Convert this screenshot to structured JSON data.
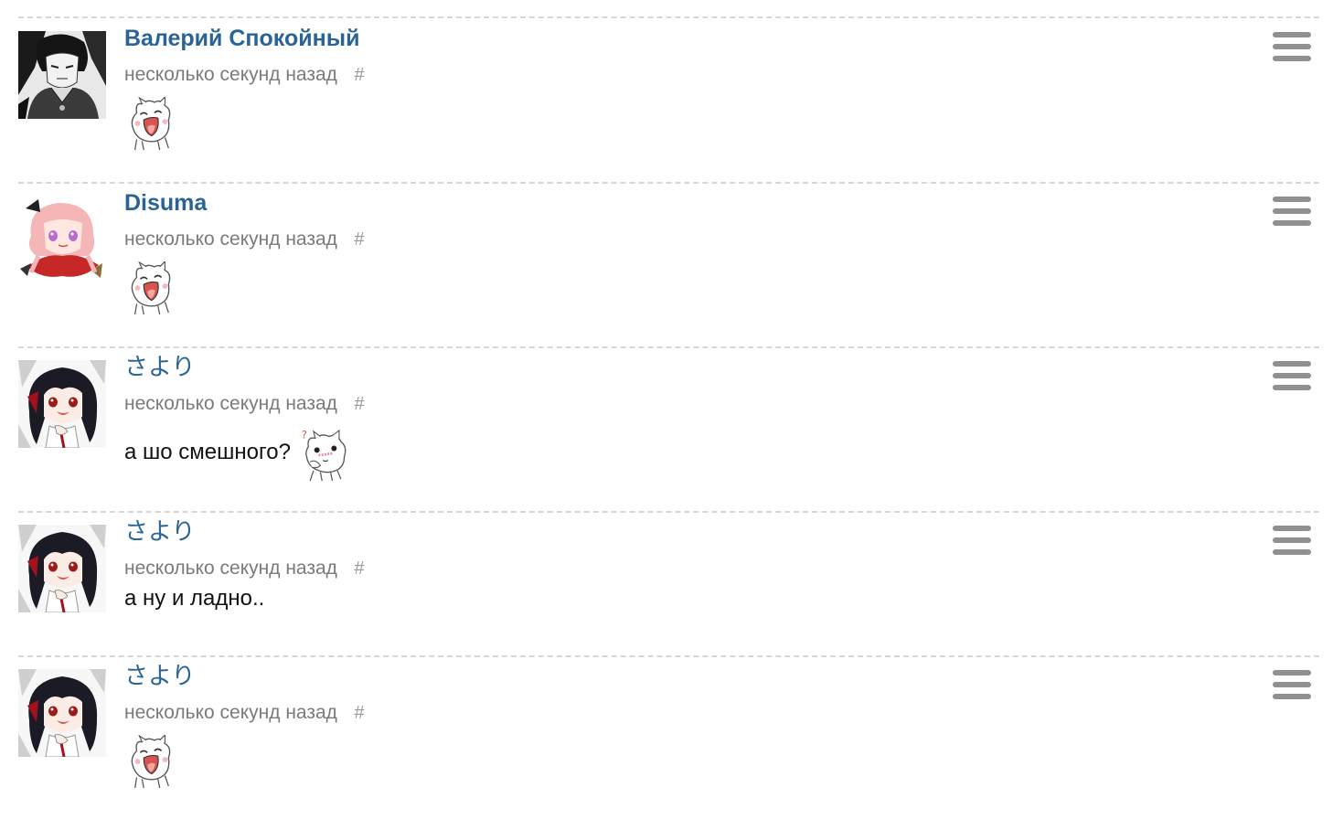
{
  "comments": [
    {
      "username": "Валерий Спокойный",
      "timestamp": "несколько секунд назад",
      "permalink": "#",
      "text": "",
      "sticker": "laughing-cat-sticker"
    },
    {
      "username": "Disuma",
      "timestamp": "несколько секунд назад",
      "permalink": "#",
      "text": "",
      "sticker": "laughing-cat-sticker"
    },
    {
      "username": "さより",
      "timestamp": "несколько секунд назад",
      "permalink": "#",
      "text": "а шо смешного?",
      "sticker": "confused-cat-sticker"
    },
    {
      "username": "さより",
      "timestamp": "несколько секунд назад",
      "permalink": "#",
      "text": "а ну и ладно..",
      "sticker": ""
    },
    {
      "username": "さより",
      "timestamp": "несколько секунд назад",
      "permalink": "#",
      "text": "",
      "sticker": "laughing-cat-sticker"
    }
  ],
  "icons": {
    "menu": "hamburger-menu-icon"
  },
  "colors": {
    "username": "#2a6496",
    "timestamp": "#7b7b7b",
    "divider": "#d6d6d6",
    "menu_icon": "#909090",
    "body_text": "#111111"
  }
}
